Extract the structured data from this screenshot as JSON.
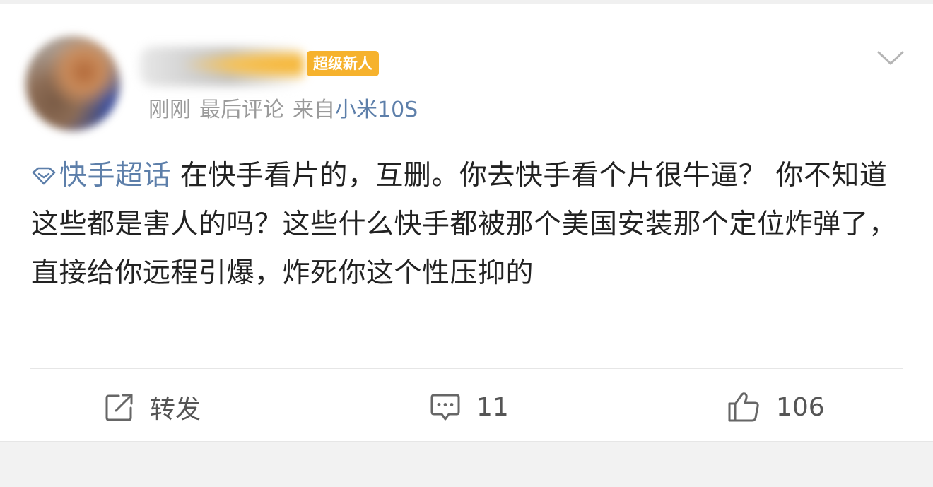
{
  "post": {
    "badge": "超级新人",
    "meta": {
      "time": "刚刚",
      "status": "最后评论",
      "source_prefix": "来自",
      "device": "小米10S"
    },
    "topic": "快手超话",
    "text": "在快手看片的，互删。你去快手看个片很牛逼？ 你不知道这些都是害人的吗？这些什么快手都被那个美国安装那个定位炸弹了，直接给你远程引爆，炸死你这个性压抑的"
  },
  "actions": {
    "repost_label": "转发",
    "comment_count": "11",
    "like_count": "106"
  },
  "colors": {
    "link_blue": "#5d7faa",
    "badge_orange": "#f6b22d",
    "meta_gray": "#9a9a9a",
    "text": "#222222"
  },
  "icons": [
    "chevron-down-icon",
    "topic-diamond-icon",
    "repost-icon",
    "comment-icon",
    "like-icon"
  ]
}
